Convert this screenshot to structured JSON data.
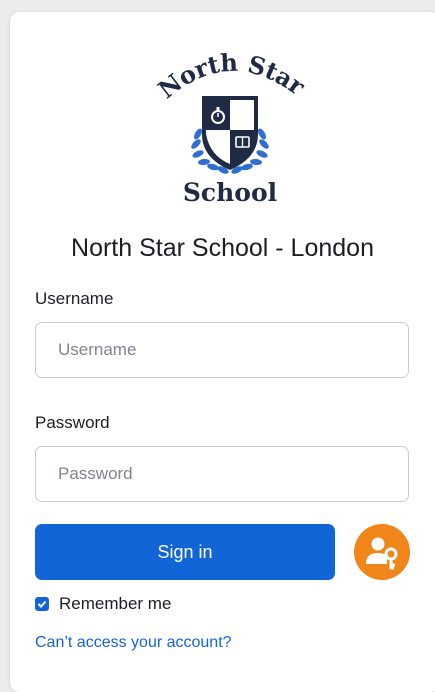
{
  "logo": {
    "top_text": "North Star",
    "bottom_text": "School",
    "icon": "north-star-crest-logo"
  },
  "title": "North Star School - London",
  "username": {
    "label": "Username",
    "placeholder": "Username",
    "value": ""
  },
  "password": {
    "label": "Password",
    "placeholder": "Password",
    "value": ""
  },
  "signin_label": "Sign in",
  "passkey_button": {
    "icon": "person-key-icon"
  },
  "remember": {
    "label": "Remember me",
    "checked": true
  },
  "forgot_link": "Can’t access your account?",
  "colors": {
    "primary": "#1265d6",
    "accent_orange": "#f0851a",
    "logo_navy": "#1f2a44",
    "laurel_blue": "#2f6fd1"
  }
}
